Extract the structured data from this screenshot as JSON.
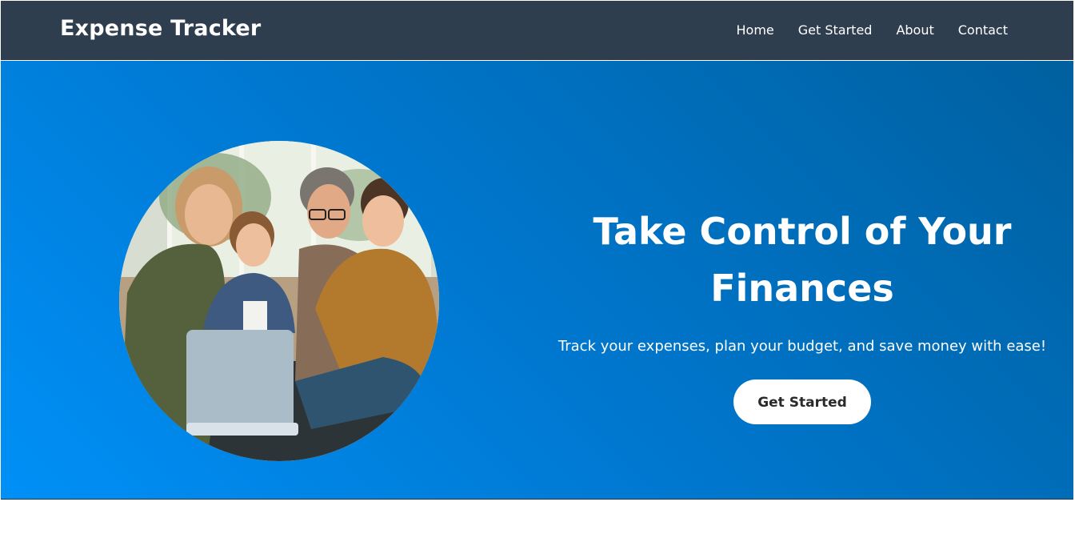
{
  "navbar": {
    "brand": "Expense Tracker",
    "links": [
      "Home",
      "Get Started",
      "About",
      "Contact"
    ]
  },
  "hero": {
    "title": "Take Control of Your Finances",
    "subtitle": "Track your expenses, plan your budget, and save money with ease!",
    "cta_label": "Get Started",
    "image_subject": "family using a laptop together"
  },
  "colors": {
    "navbar_bg": "#2f3e4f",
    "hero_gradient_start": "#0090f7",
    "hero_gradient_end": "#00609f",
    "cta_bg": "#ffffff",
    "cta_text": "#2a2a2a"
  }
}
